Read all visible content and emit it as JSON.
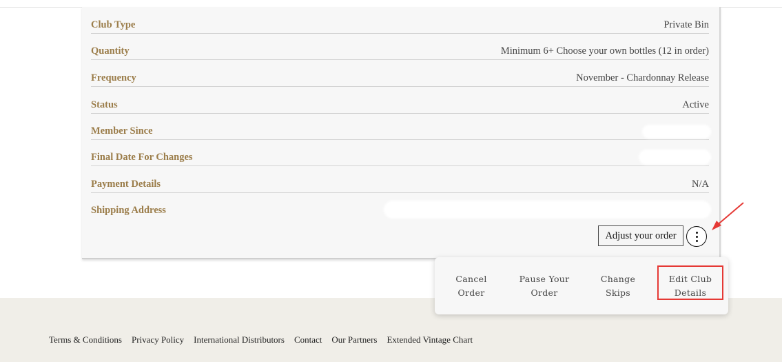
{
  "club_details": {
    "rows": [
      {
        "label": "Club Type",
        "value": "Private Bin"
      },
      {
        "label": "Quantity",
        "value": "Minimum 6+ Choose your own bottles (12 in order)"
      },
      {
        "label": "Frequency",
        "value": "November - Chardonnay Release"
      },
      {
        "label": "Status",
        "value": "Active"
      },
      {
        "label": "Member Since",
        "value": ""
      },
      {
        "label": "Final Date For Changes",
        "value": ""
      },
      {
        "label": "Payment Details",
        "value": "N/A"
      },
      {
        "label": "Shipping Address",
        "value": ""
      }
    ],
    "adjust_label": "Adjust your order",
    "more_icon": "kebab-vertical-icon"
  },
  "actions_menu": {
    "items": [
      {
        "line1": "Cancel",
        "line2": "Order"
      },
      {
        "line1": "Pause Your",
        "line2": "Order"
      },
      {
        "line1": "Change",
        "line2": "Skips"
      },
      {
        "line1": "Edit Club",
        "line2": "Details"
      }
    ],
    "highlight_color": "#e53935"
  },
  "annotation": {
    "arrow_color": "#e53935"
  },
  "footer": {
    "links": [
      "Terms & Conditions",
      "Privacy Policy",
      "International Distributors",
      "Contact",
      "Our Partners",
      "Extended Vintage Chart"
    ]
  },
  "colors": {
    "label_gold": "#9b7d4a",
    "footer_bg": "#f0eee8"
  }
}
